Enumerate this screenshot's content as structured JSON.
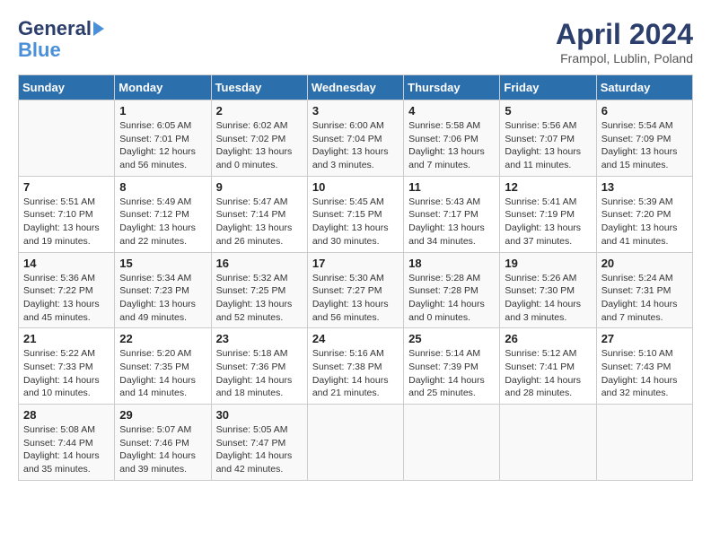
{
  "header": {
    "logo_line1": "General",
    "logo_line2": "Blue",
    "title": "April 2024",
    "location": "Frampol, Lublin, Poland"
  },
  "days_of_week": [
    "Sunday",
    "Monday",
    "Tuesday",
    "Wednesday",
    "Thursday",
    "Friday",
    "Saturday"
  ],
  "weeks": [
    [
      {
        "day": "",
        "info": ""
      },
      {
        "day": "1",
        "info": "Sunrise: 6:05 AM\nSunset: 7:01 PM\nDaylight: 12 hours\nand 56 minutes."
      },
      {
        "day": "2",
        "info": "Sunrise: 6:02 AM\nSunset: 7:02 PM\nDaylight: 13 hours\nand 0 minutes."
      },
      {
        "day": "3",
        "info": "Sunrise: 6:00 AM\nSunset: 7:04 PM\nDaylight: 13 hours\nand 3 minutes."
      },
      {
        "day": "4",
        "info": "Sunrise: 5:58 AM\nSunset: 7:06 PM\nDaylight: 13 hours\nand 7 minutes."
      },
      {
        "day": "5",
        "info": "Sunrise: 5:56 AM\nSunset: 7:07 PM\nDaylight: 13 hours\nand 11 minutes."
      },
      {
        "day": "6",
        "info": "Sunrise: 5:54 AM\nSunset: 7:09 PM\nDaylight: 13 hours\nand 15 minutes."
      }
    ],
    [
      {
        "day": "7",
        "info": "Sunrise: 5:51 AM\nSunset: 7:10 PM\nDaylight: 13 hours\nand 19 minutes."
      },
      {
        "day": "8",
        "info": "Sunrise: 5:49 AM\nSunset: 7:12 PM\nDaylight: 13 hours\nand 22 minutes."
      },
      {
        "day": "9",
        "info": "Sunrise: 5:47 AM\nSunset: 7:14 PM\nDaylight: 13 hours\nand 26 minutes."
      },
      {
        "day": "10",
        "info": "Sunrise: 5:45 AM\nSunset: 7:15 PM\nDaylight: 13 hours\nand 30 minutes."
      },
      {
        "day": "11",
        "info": "Sunrise: 5:43 AM\nSunset: 7:17 PM\nDaylight: 13 hours\nand 34 minutes."
      },
      {
        "day": "12",
        "info": "Sunrise: 5:41 AM\nSunset: 7:19 PM\nDaylight: 13 hours\nand 37 minutes."
      },
      {
        "day": "13",
        "info": "Sunrise: 5:39 AM\nSunset: 7:20 PM\nDaylight: 13 hours\nand 41 minutes."
      }
    ],
    [
      {
        "day": "14",
        "info": "Sunrise: 5:36 AM\nSunset: 7:22 PM\nDaylight: 13 hours\nand 45 minutes."
      },
      {
        "day": "15",
        "info": "Sunrise: 5:34 AM\nSunset: 7:23 PM\nDaylight: 13 hours\nand 49 minutes."
      },
      {
        "day": "16",
        "info": "Sunrise: 5:32 AM\nSunset: 7:25 PM\nDaylight: 13 hours\nand 52 minutes."
      },
      {
        "day": "17",
        "info": "Sunrise: 5:30 AM\nSunset: 7:27 PM\nDaylight: 13 hours\nand 56 minutes."
      },
      {
        "day": "18",
        "info": "Sunrise: 5:28 AM\nSunset: 7:28 PM\nDaylight: 14 hours\nand 0 minutes."
      },
      {
        "day": "19",
        "info": "Sunrise: 5:26 AM\nSunset: 7:30 PM\nDaylight: 14 hours\nand 3 minutes."
      },
      {
        "day": "20",
        "info": "Sunrise: 5:24 AM\nSunset: 7:31 PM\nDaylight: 14 hours\nand 7 minutes."
      }
    ],
    [
      {
        "day": "21",
        "info": "Sunrise: 5:22 AM\nSunset: 7:33 PM\nDaylight: 14 hours\nand 10 minutes."
      },
      {
        "day": "22",
        "info": "Sunrise: 5:20 AM\nSunset: 7:35 PM\nDaylight: 14 hours\nand 14 minutes."
      },
      {
        "day": "23",
        "info": "Sunrise: 5:18 AM\nSunset: 7:36 PM\nDaylight: 14 hours\nand 18 minutes."
      },
      {
        "day": "24",
        "info": "Sunrise: 5:16 AM\nSunset: 7:38 PM\nDaylight: 14 hours\nand 21 minutes."
      },
      {
        "day": "25",
        "info": "Sunrise: 5:14 AM\nSunset: 7:39 PM\nDaylight: 14 hours\nand 25 minutes."
      },
      {
        "day": "26",
        "info": "Sunrise: 5:12 AM\nSunset: 7:41 PM\nDaylight: 14 hours\nand 28 minutes."
      },
      {
        "day": "27",
        "info": "Sunrise: 5:10 AM\nSunset: 7:43 PM\nDaylight: 14 hours\nand 32 minutes."
      }
    ],
    [
      {
        "day": "28",
        "info": "Sunrise: 5:08 AM\nSunset: 7:44 PM\nDaylight: 14 hours\nand 35 minutes."
      },
      {
        "day": "29",
        "info": "Sunrise: 5:07 AM\nSunset: 7:46 PM\nDaylight: 14 hours\nand 39 minutes."
      },
      {
        "day": "30",
        "info": "Sunrise: 5:05 AM\nSunset: 7:47 PM\nDaylight: 14 hours\nand 42 minutes."
      },
      {
        "day": "",
        "info": ""
      },
      {
        "day": "",
        "info": ""
      },
      {
        "day": "",
        "info": ""
      },
      {
        "day": "",
        "info": ""
      }
    ]
  ]
}
